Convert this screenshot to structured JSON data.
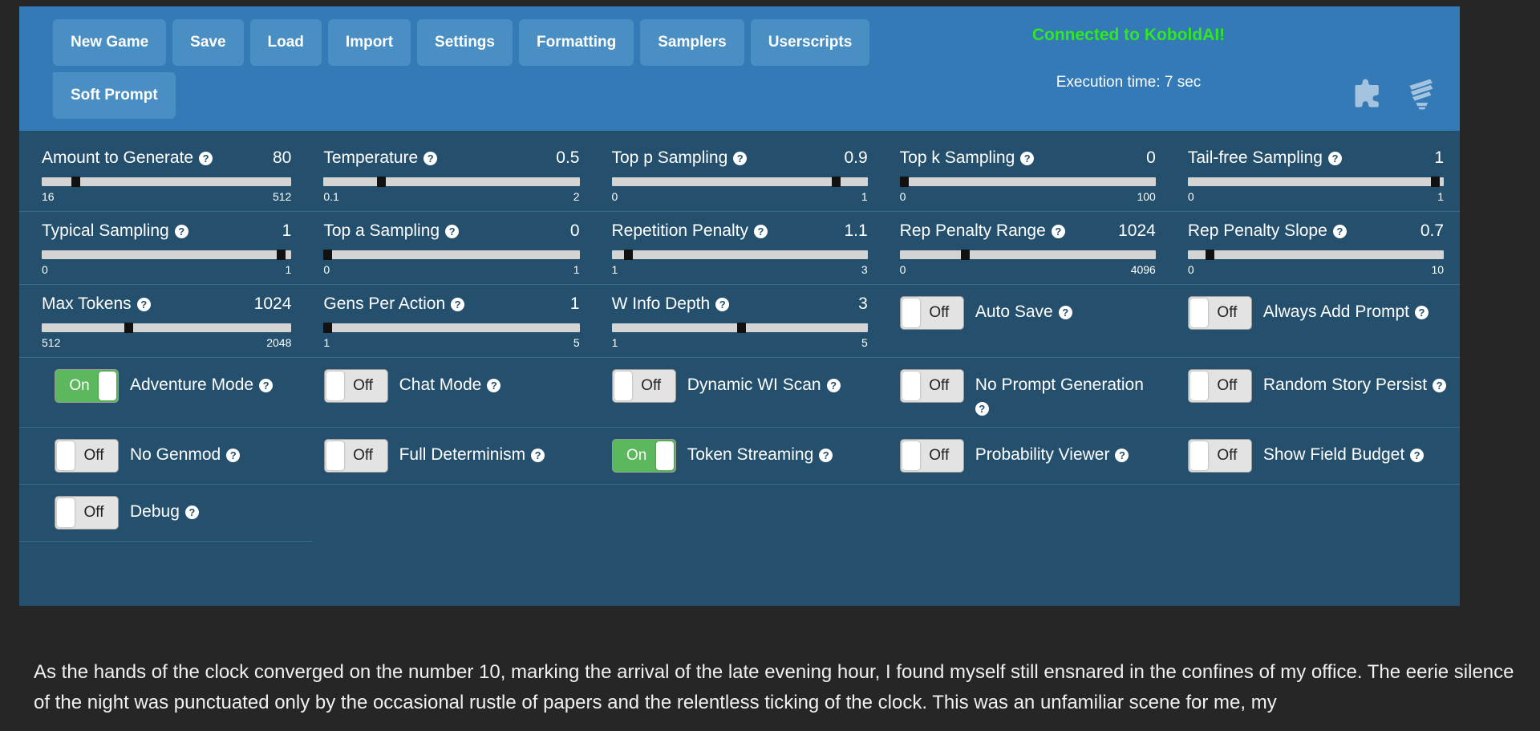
{
  "menu": {
    "buttons_row1": [
      {
        "label": "New Game",
        "name": "new-game"
      },
      {
        "label": "Save",
        "name": "save"
      },
      {
        "label": "Load",
        "name": "load"
      },
      {
        "label": "Import",
        "name": "import"
      },
      {
        "label": "Settings",
        "name": "settings"
      },
      {
        "label": "Formatting",
        "name": "formatting"
      },
      {
        "label": "Samplers",
        "name": "samplers"
      },
      {
        "label": "Userscripts",
        "name": "userscripts"
      }
    ],
    "buttons_row2": [
      {
        "label": "Soft Prompt",
        "name": "soft-prompt"
      }
    ],
    "connection_status": "Connected to KoboldAI!",
    "execution_time": "Execution time: 7 sec",
    "icons": [
      "puzzle-piece-icon",
      "lightbulb-icon"
    ]
  },
  "colors": {
    "header_blue": "#337ab7",
    "panel_blue": "#24506e",
    "button_blue": "#4a8fc4",
    "connected_green": "#2fe81f",
    "toggle_on_green": "#5cb85c",
    "track_gray": "#d4d4d4",
    "story_bg": "#262626"
  },
  "sliders": [
    {
      "label": "Amount to Generate",
      "value": "80",
      "min": "16",
      "max": "512",
      "pct": 12
    },
    {
      "label": "Temperature",
      "value": "0.5",
      "min": "0.1",
      "max": "2",
      "pct": 21
    },
    {
      "label": "Top p Sampling",
      "value": "0.9",
      "min": "0",
      "max": "1",
      "pct": 89
    },
    {
      "label": "Top k Sampling",
      "value": "0",
      "min": "0",
      "max": "100",
      "pct": 0
    },
    {
      "label": "Tail-free Sampling",
      "value": "1",
      "min": "0",
      "max": "1",
      "pct": 97
    },
    {
      "label": "Typical Sampling",
      "value": "1",
      "min": "0",
      "max": "1",
      "pct": 96
    },
    {
      "label": "Top a Sampling",
      "value": "0",
      "min": "0",
      "max": "1",
      "pct": 0
    },
    {
      "label": "Repetition Penalty",
      "value": "1.1",
      "min": "1",
      "max": "3",
      "pct": 5
    },
    {
      "label": "Rep Penalty Range",
      "value": "1024",
      "min": "0",
      "max": "4096",
      "pct": 25
    },
    {
      "label": "Rep Penalty Slope",
      "value": "0.7",
      "min": "0",
      "max": "10",
      "pct": 7
    },
    {
      "label": "Max Tokens",
      "value": "1024",
      "min": "512",
      "max": "2048",
      "pct": 34
    },
    {
      "label": "Gens Per Action",
      "value": "1",
      "min": "1",
      "max": "5",
      "pct": 0
    },
    {
      "label": "W Info Depth",
      "value": "3",
      "min": "1",
      "max": "5",
      "pct": 50
    }
  ],
  "toggles": [
    {
      "label": "Auto Save",
      "state": "Off",
      "on": false
    },
    {
      "label": "Always Add Prompt",
      "state": "Off",
      "on": false
    },
    {
      "label": "Adventure Mode",
      "state": "On",
      "on": true
    },
    {
      "label": "Chat Mode",
      "state": "Off",
      "on": false
    },
    {
      "label": "Dynamic WI Scan",
      "state": "Off",
      "on": false
    },
    {
      "label": "No Prompt Generation",
      "state": "Off",
      "on": false
    },
    {
      "label": "Random Story Persist",
      "state": "Off",
      "on": false
    },
    {
      "label": "No Genmod",
      "state": "Off",
      "on": false
    },
    {
      "label": "Full Determinism",
      "state": "Off",
      "on": false
    },
    {
      "label": "Token Streaming",
      "state": "On",
      "on": true
    },
    {
      "label": "Probability Viewer",
      "state": "Off",
      "on": false
    },
    {
      "label": "Show Field Budget",
      "state": "Off",
      "on": false
    },
    {
      "label": "Debug",
      "state": "Off",
      "on": false
    }
  ],
  "story": {
    "text": "As the hands of the clock converged on the number 10, marking the arrival of the late evening hour, I found myself still ensnared in the confines of my office. The eerie silence of the night was punctuated only by the occasional rustle of papers and the relentless ticking of the clock. This was an unfamiliar scene for me, my"
  },
  "help_glyph": "?"
}
